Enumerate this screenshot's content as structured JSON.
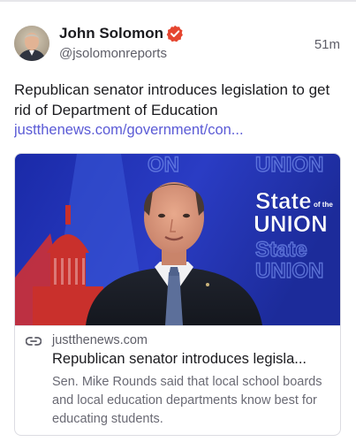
{
  "author": {
    "name": "John Solomon",
    "handle": "@jsolomonreports",
    "verified_icon": "verified-badge-icon",
    "verified_color": "#e5452f"
  },
  "post": {
    "time": "51m",
    "text": "Republican senator introduces legislation to get rid of Department of Education",
    "link": "justthenews.com/government/con..."
  },
  "card": {
    "domain": "justthenews.com",
    "title": "Republican senator introduces legisla...",
    "description": "Sen. Mike Rounds said that local school boards and local education departments know best for educating students.",
    "image_logo": {
      "line1": "State",
      "line1_small": "of the",
      "line2": "UNION"
    }
  },
  "colors": {
    "link": "#5b5bd6",
    "muted": "#5e5e68"
  }
}
